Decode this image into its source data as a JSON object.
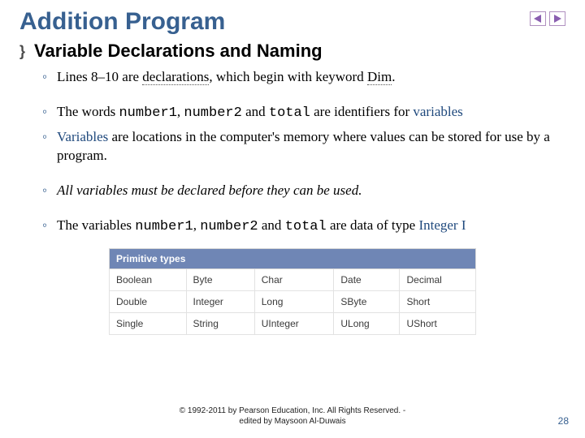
{
  "title": "Addition Program",
  "subhead": "Variable Declarations and Naming",
  "bullets": {
    "b1_a": "Lines 8–10 are ",
    "b1_decl": "declarations",
    "b1_b": ", which begin with keyword ",
    "b1_dim": "Dim",
    "b1_c": ".",
    "b2_a": "The words ",
    "b2_n1": "number1",
    "b2_b": ", ",
    "b2_n2": "number2",
    "b2_c": " and ",
    "b2_tot": "total",
    "b2_d": " are identifiers for ",
    "b2_vars": "variables",
    "b3_a": "Variables",
    "b3_b": " are locations in the computer's memory where values can be stored for use by a program.",
    "b4": "All variables must be declared before they can be used.",
    "b5_a": "The variables ",
    "b5_n1": "number1",
    "b5_b": ", ",
    "b5_n2": "number2",
    "b5_c": " and ",
    "b5_tot": "total",
    "b5_d": " are data of type ",
    "b5_int": "Integer I"
  },
  "table": {
    "header": "Primitive types",
    "rows": [
      [
        "Boolean",
        "Byte",
        "Char",
        "Date",
        "Decimal"
      ],
      [
        "Double",
        "Integer",
        "Long",
        "SByte",
        "Short"
      ],
      [
        "Single",
        "String",
        "UInteger",
        "ULong",
        "UShort"
      ]
    ]
  },
  "footer": {
    "line1": "© 1992-2011 by Pearson Education, Inc. All Rights Reserved. -",
    "line2": "edited by Maysoon Al-Duwais"
  },
  "page": "28"
}
